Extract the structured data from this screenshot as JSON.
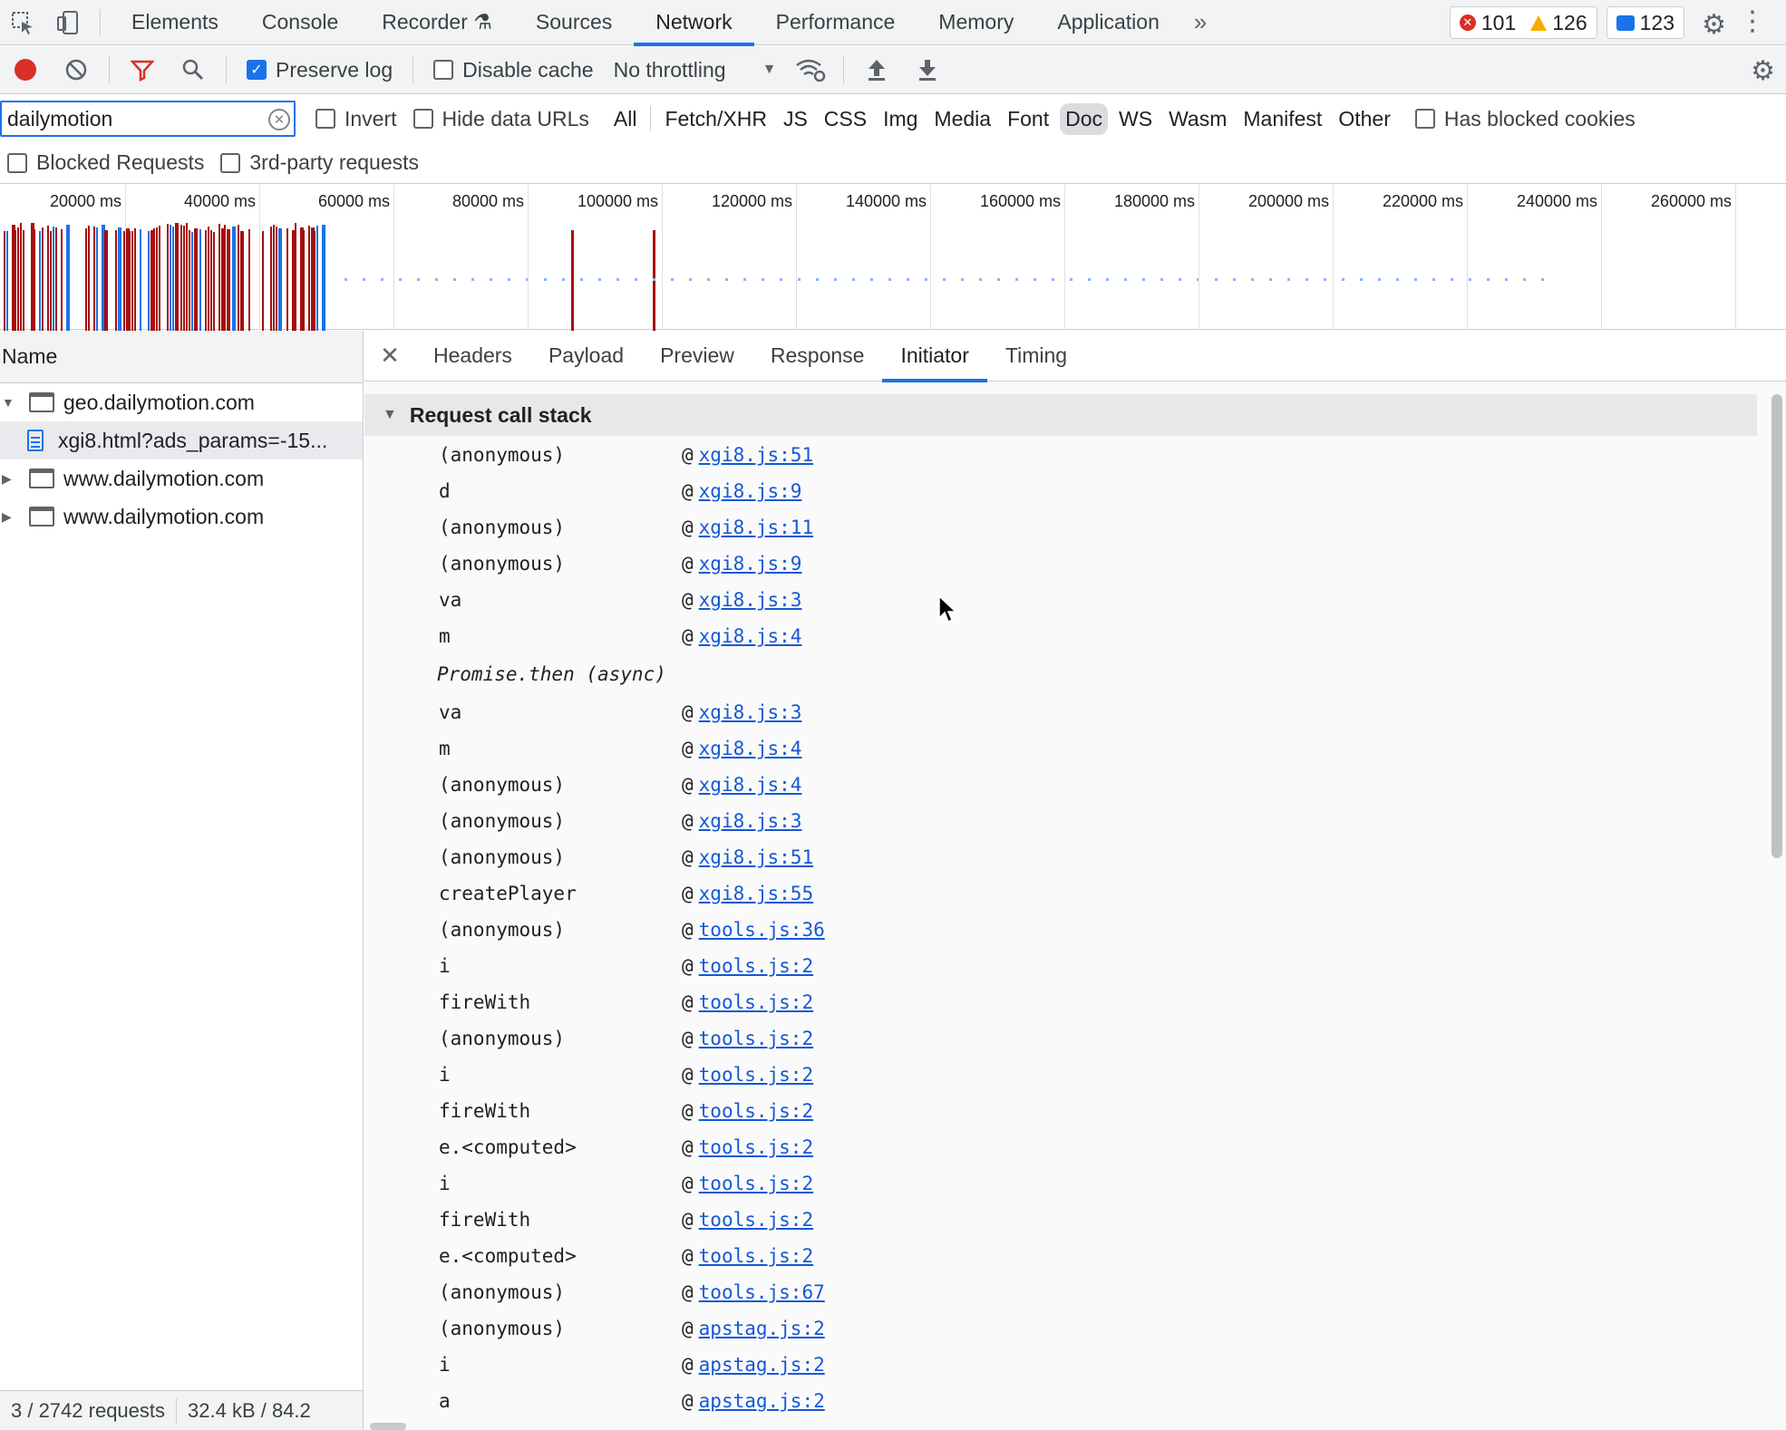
{
  "topbar": {
    "tabs": [
      "Elements",
      "Console",
      "Recorder",
      "Sources",
      "Network",
      "Performance",
      "Memory",
      "Application"
    ],
    "active_tab": "Network",
    "more": "»",
    "errors": "101",
    "warnings": "126",
    "messages": "123"
  },
  "toolbar": {
    "preserve_log": "Preserve log",
    "disable_cache": "Disable cache",
    "throttling": "No throttling"
  },
  "filter": {
    "value": "dailymotion",
    "invert": "Invert",
    "hide_data_urls": "Hide data URLs",
    "types": [
      "All",
      "Fetch/XHR",
      "JS",
      "CSS",
      "Img",
      "Media",
      "Font",
      "Doc",
      "WS",
      "Wasm",
      "Manifest",
      "Other"
    ],
    "active_type": "Doc",
    "has_blocked_cookies": "Has blocked cookies",
    "blocked_requests": "Blocked Requests",
    "third_party": "3rd-party requests"
  },
  "overview": {
    "ticks": [
      "20000 ms",
      "40000 ms",
      "60000 ms",
      "80000 ms",
      "100000 ms",
      "120000 ms",
      "140000 ms",
      "160000 ms",
      "180000 ms",
      "200000 ms",
      "220000 ms",
      "240000 ms",
      "260000 ms"
    ],
    "colors": {
      "red": "#a50e0e",
      "blue": "#1a73e8",
      "light": "#8ab4f8"
    }
  },
  "requests": {
    "header": "Name",
    "rows": [
      {
        "name": "geo.dailymotion.com",
        "kind": "frame",
        "expanded": true
      },
      {
        "name": "xgi8.html?ads_params=-15...",
        "kind": "doc",
        "selected": true
      },
      {
        "name": "www.dailymotion.com",
        "kind": "frame",
        "expanded": false
      },
      {
        "name": "www.dailymotion.com",
        "kind": "frame",
        "expanded": false
      }
    ],
    "status_count": "3 / 2742 requests",
    "status_size": "32.4 kB / 84.2"
  },
  "detail": {
    "tabs": [
      "Headers",
      "Payload",
      "Preview",
      "Response",
      "Initiator",
      "Timing"
    ],
    "active_tab": "Initiator",
    "section_title": "Request call stack",
    "stack": [
      {
        "fn": "(anonymous)",
        "src": "xgi8.js:51"
      },
      {
        "fn": "d",
        "src": "xgi8.js:9"
      },
      {
        "fn": "(anonymous)",
        "src": "xgi8.js:11"
      },
      {
        "fn": "(anonymous)",
        "src": "xgi8.js:9"
      },
      {
        "fn": "va",
        "src": "xgi8.js:3"
      },
      {
        "fn": "m",
        "src": "xgi8.js:4"
      },
      {
        "async": "Promise.then (async)"
      },
      {
        "fn": "va",
        "src": "xgi8.js:3"
      },
      {
        "fn": "m",
        "src": "xgi8.js:4"
      },
      {
        "fn": "(anonymous)",
        "src": "xgi8.js:4"
      },
      {
        "fn": "(anonymous)",
        "src": "xgi8.js:3"
      },
      {
        "fn": "(anonymous)",
        "src": "xgi8.js:51"
      },
      {
        "fn": "createPlayer",
        "src": "xgi8.js:55"
      },
      {
        "fn": "(anonymous)",
        "src": "tools.js:36"
      },
      {
        "fn": "i",
        "src": "tools.js:2"
      },
      {
        "fn": "fireWith",
        "src": "tools.js:2"
      },
      {
        "fn": "(anonymous)",
        "src": "tools.js:2"
      },
      {
        "fn": "i",
        "src": "tools.js:2"
      },
      {
        "fn": "fireWith",
        "src": "tools.js:2"
      },
      {
        "fn": "e.<computed>",
        "src": "tools.js:2"
      },
      {
        "fn": "i",
        "src": "tools.js:2"
      },
      {
        "fn": "fireWith",
        "src": "tools.js:2"
      },
      {
        "fn": "e.<computed>",
        "src": "tools.js:2"
      },
      {
        "fn": "(anonymous)",
        "src": "tools.js:67"
      },
      {
        "fn": "(anonymous)",
        "src": "apstag.js:2"
      },
      {
        "fn": "i",
        "src": "apstag.js:2"
      },
      {
        "fn": "a",
        "src": "apstag.js:2"
      }
    ]
  }
}
